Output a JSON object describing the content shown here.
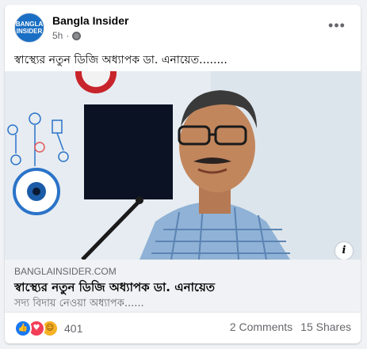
{
  "post": {
    "page_name": "Bangla Insider",
    "avatar_text_1": "BANGLA",
    "avatar_text_2": "INSIDER",
    "time": "5h",
    "privacy_icon": "globe-icon",
    "text": "স্বাস্থ্যের নতুন ডিজি অধ্যাপক ডা. এনায়েত........"
  },
  "link": {
    "domain": "BANGLAINSIDER.COM",
    "title": "স্বাস্থ্যের নতুন ডিজি অধ্যাপক ডা. এনায়েত",
    "description": "সদ্য বিদায় নেওয়া অধ্যাপক......"
  },
  "footer": {
    "reaction_count": "401",
    "comments": "2 Comments",
    "shares": "15 Shares"
  },
  "colors": {
    "like": "#1877f2",
    "love": "#f33e58",
    "haha": "#f7b125"
  }
}
